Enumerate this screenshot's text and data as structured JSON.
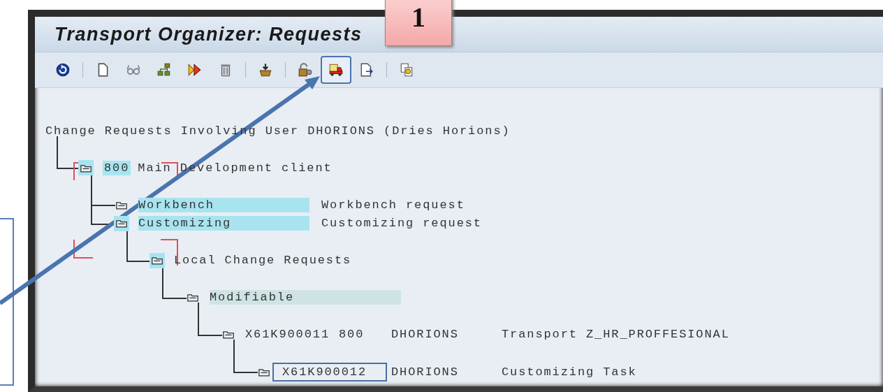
{
  "callout": {
    "label": "1"
  },
  "window": {
    "title": "Transport Organizer: Requests"
  },
  "toolbar": [
    {
      "kind": "refresh",
      "selected": false
    },
    {
      "kind": "separator"
    },
    {
      "kind": "document",
      "selected": false
    },
    {
      "kind": "glasses",
      "selected": false
    },
    {
      "kind": "hierarchy",
      "selected": false
    },
    {
      "kind": "forward",
      "selected": false
    },
    {
      "kind": "trash",
      "selected": false
    },
    {
      "kind": "separator"
    },
    {
      "kind": "import",
      "selected": false
    },
    {
      "kind": "separator"
    },
    {
      "kind": "lock",
      "selected": false
    },
    {
      "kind": "truck",
      "selected": true
    },
    {
      "kind": "edit",
      "selected": false
    },
    {
      "kind": "separator"
    },
    {
      "kind": "copy",
      "selected": false
    }
  ],
  "tree": {
    "title": "Change Requests Involving User DHORIONS (Dries Horions)",
    "children": [
      {
        "kind": "client",
        "client": "800",
        "name": "Main Development client",
        "icon_highlight": true,
        "selected": false,
        "children": [
          {
            "kind": "request_type",
            "name": "Workbench",
            "description": "Workbench request",
            "icon_highlight": false,
            "selected": false
          },
          {
            "kind": "request_type",
            "name": "Customizing",
            "description": "Customizing request",
            "icon_highlight": true,
            "selected": false,
            "children": [
              {
                "kind": "plain",
                "name": "Local Change Requests",
                "icon_highlight": true,
                "selected": false,
                "children": [
                  {
                    "kind": "status",
                    "name": "Modifiable",
                    "icon_highlight": false,
                    "selected": false,
                    "children": [
                      {
                        "kind": "request",
                        "name": "X61K900011",
                        "client": "800",
                        "user": "DHORIONS",
                        "description": "Transport Z_HR_PROFFESIONAL",
                        "icon_highlight": false,
                        "selected": false,
                        "children": [
                          {
                            "kind": "task",
                            "name": "X61K900012",
                            "user": "DHORIONS",
                            "description": "Customizing Task",
                            "icon_highlight": false,
                            "selected": true
                          }
                        ]
                      }
                    ]
                  }
                ]
              }
            ]
          }
        ]
      }
    ]
  }
}
